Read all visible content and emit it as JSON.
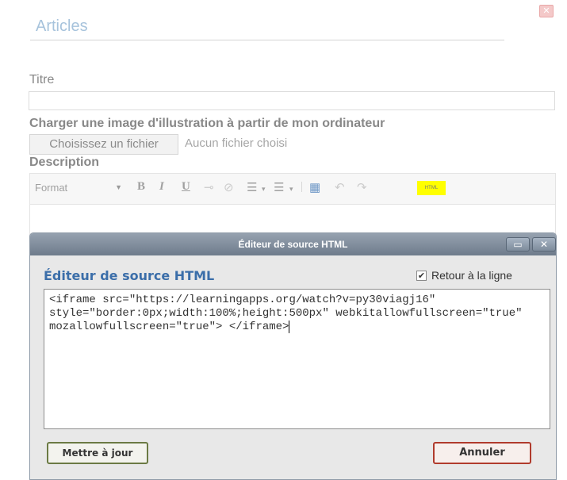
{
  "page": {
    "section_title": "Articles",
    "close_icon": "close-icon",
    "fields": {
      "titre_label": "Titre",
      "titre_value": "",
      "image_label": "Charger une image d'illustration à partir de mon ordinateur",
      "file_button": "Choisissez un fichier",
      "file_status": "Aucun fichier choisi",
      "description_label": "Description"
    },
    "toolbar": {
      "format": "Format",
      "bold": "B",
      "italic": "I",
      "underline": "U",
      "html_button": "HTML",
      "html_highlight_color": "#ffff00"
    }
  },
  "dialog": {
    "title": "Éditeur de source HTML",
    "heading": "Éditeur de source HTML",
    "wrap_label": "Retour à la ligne",
    "wrap_checked": true,
    "source_code": "<iframe src=\"https://learningapps.org/watch?v=py30viagj16\" style=\"border:0px;width:100%;height:500px\" webkitallowfullscreen=\"true\" mozallowfullscreen=\"true\"> </iframe>",
    "update_button": "Mettre à jour",
    "cancel_button": "Annuler",
    "titlebar_color": "#7d8a9a",
    "heading_color": "#3b6ea9"
  }
}
